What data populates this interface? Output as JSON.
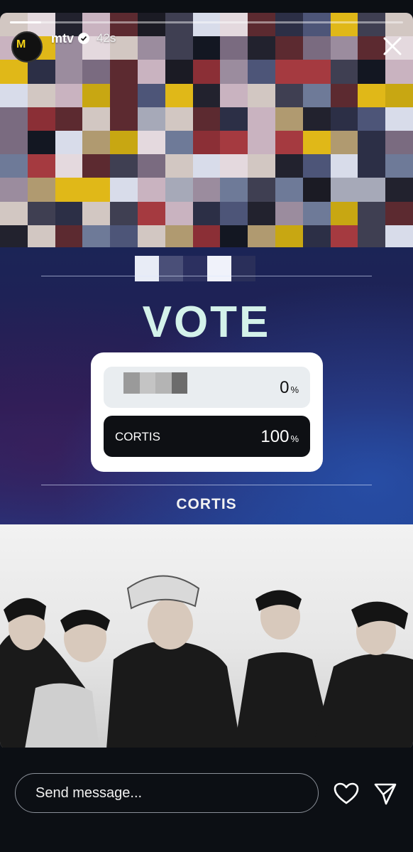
{
  "header": {
    "username": "mtv",
    "timestamp": "42s",
    "avatar_logo": "M",
    "verified_icon": "verified-badge-icon",
    "close_icon": "close-icon"
  },
  "story": {
    "progress": 0.08,
    "poll": {
      "title": "VOTE",
      "options": [
        {
          "label": "",
          "percent": "0",
          "unit": "%"
        },
        {
          "label": "CORTIS",
          "percent": "100",
          "unit": "%"
        }
      ]
    },
    "caption": "CORTIS"
  },
  "footer": {
    "message_placeholder": "Send message...",
    "like_icon": "heart-icon",
    "share_icon": "send-icon"
  },
  "colors": {
    "vote_title": "#d4f2ea",
    "background": "#0c0f14",
    "poll_winner_bg": "#0e1014",
    "logo_yellow": "#f7d417"
  }
}
